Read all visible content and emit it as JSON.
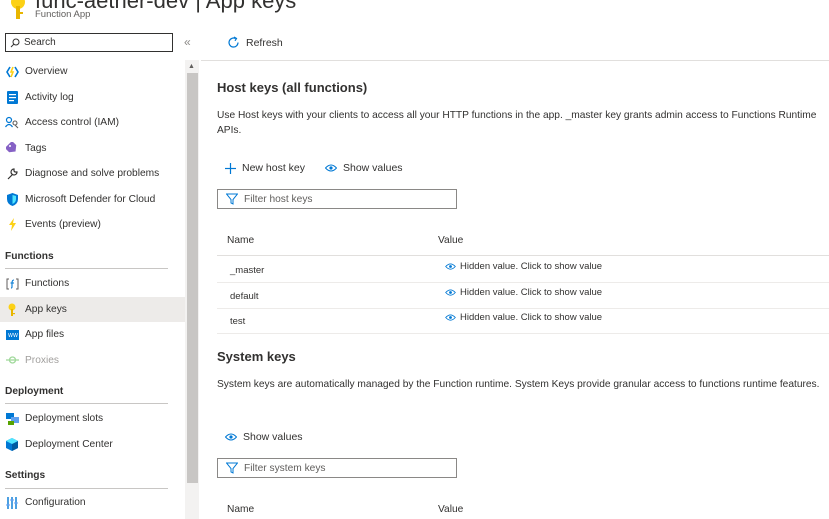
{
  "header": {
    "title": "func-aether-dev | App keys",
    "subtitle": "Function App"
  },
  "sidebar": {
    "search_placeholder": "Search",
    "collapse_label": "«",
    "items_top": [
      {
        "label": "Overview",
        "icon": "overview-icon"
      },
      {
        "label": "Activity log",
        "icon": "activity-log-icon"
      },
      {
        "label": "Access control (IAM)",
        "icon": "iam-icon"
      },
      {
        "label": "Tags",
        "icon": "tag-icon"
      },
      {
        "label": "Diagnose and solve problems",
        "icon": "wrench-icon"
      },
      {
        "label": "Microsoft Defender for Cloud",
        "icon": "shield-icon"
      },
      {
        "label": "Events (preview)",
        "icon": "lightning-icon"
      }
    ],
    "sections": {
      "functions": {
        "title": "Functions",
        "items": [
          {
            "label": "Functions",
            "icon": "function-icon"
          },
          {
            "label": "App keys",
            "icon": "key-icon",
            "active": true
          },
          {
            "label": "App files",
            "icon": "app-files-icon"
          },
          {
            "label": "Proxies",
            "icon": "proxy-icon",
            "disabled": true
          }
        ]
      },
      "deployment": {
        "title": "Deployment",
        "items": [
          {
            "label": "Deployment slots",
            "icon": "slots-icon"
          },
          {
            "label": "Deployment Center",
            "icon": "cube-icon"
          }
        ]
      },
      "settings": {
        "title": "Settings",
        "items": [
          {
            "label": "Configuration",
            "icon": "sliders-icon"
          }
        ]
      }
    }
  },
  "toolbar": {
    "refresh_label": "Refresh"
  },
  "host_keys": {
    "title": "Host keys (all functions)",
    "description": "Use Host keys with your clients to access all your HTTP functions in the app. _master key grants admin access to Functions Runtime APIs.",
    "new_key_label": "New host key",
    "show_values_label": "Show values",
    "filter_placeholder": "Filter host keys",
    "columns": {
      "name": "Name",
      "value": "Value"
    },
    "rows": [
      {
        "name": "_master",
        "value": "Hidden value. Click to show value"
      },
      {
        "name": "default",
        "value": "Hidden value. Click to show value"
      },
      {
        "name": "test",
        "value": "Hidden value. Click to show value"
      }
    ]
  },
  "system_keys": {
    "title": "System keys",
    "description": "System keys are automatically managed by the Function runtime. System Keys provide granular access to functions runtime features.",
    "show_values_label": "Show values",
    "filter_placeholder": "Filter system keys",
    "columns": {
      "name": "Name",
      "value": "Value"
    }
  },
  "colors": {
    "accent": "#0078d4",
    "key_yellow": "#fcd116",
    "active_bg": "#edebe9"
  }
}
